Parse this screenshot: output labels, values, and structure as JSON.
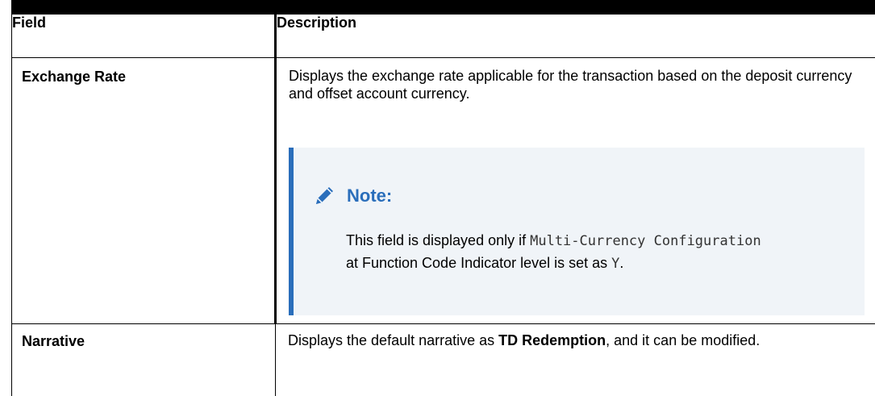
{
  "table": {
    "header": {
      "field": "Field",
      "description": "Description"
    },
    "rows": [
      {
        "field": "Exchange Rate",
        "description": "Displays the exchange rate applicable for the transaction based on the deposit currency and offset account currency.",
        "note": {
          "title": "Note:",
          "body_start": "This field is displayed only if ",
          "code_1": "Multi-Currency Configuration",
          "body_middle": " at Function Code Indicator level is set as ",
          "code_2": "Y",
          "body_end": ".",
          "icon": "pencil-icon"
        }
      },
      {
        "field": "Narrative",
        "description_start": "Displays the default narrative as ",
        "description_bold": "TD Redemption",
        "description_end": ", and it can be modified."
      }
    ]
  },
  "colors": {
    "note_accent": "#2a6ebb",
    "note_background": "#f0f4f8"
  }
}
